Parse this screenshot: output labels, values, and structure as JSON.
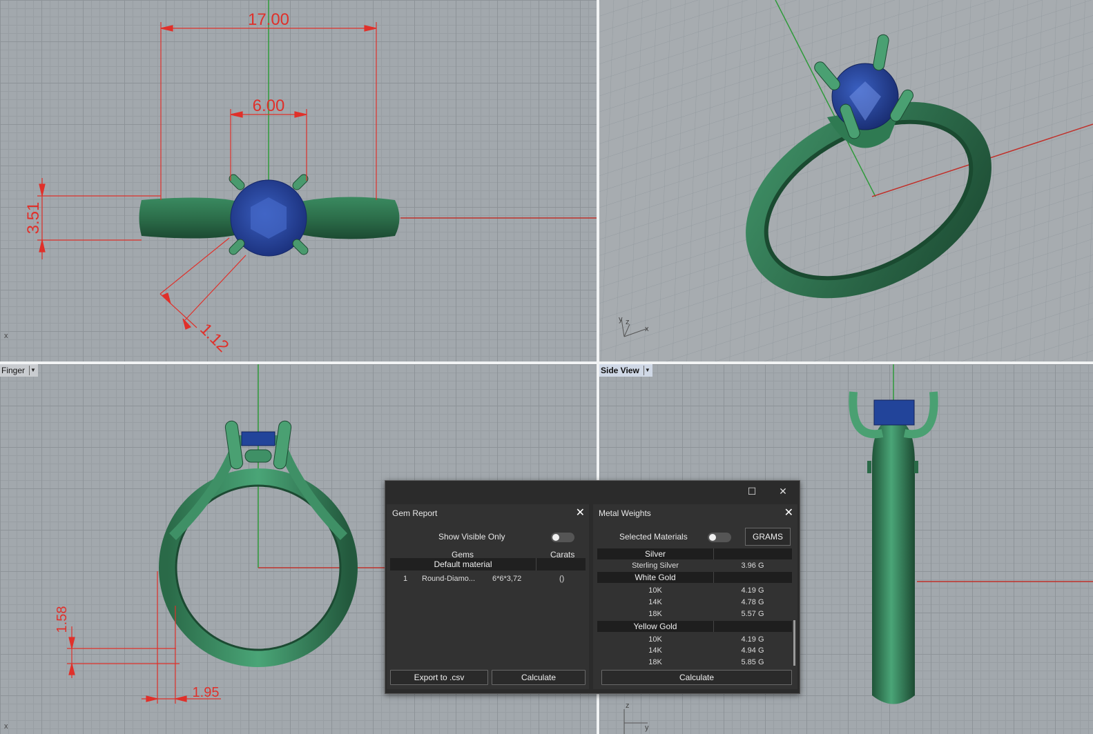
{
  "viewports": {
    "top": {
      "dims": {
        "width": "17.00",
        "inner": "6.00",
        "height": "3.51",
        "prong": "1.12"
      }
    },
    "perspective": {
      "axes": {
        "x": "x",
        "y": "y",
        "z": "z"
      }
    },
    "front": {
      "label": "Finger",
      "dims": {
        "shank_h": "1.58",
        "shank_w": "1.95"
      }
    },
    "right": {
      "label": "Side View",
      "axes": {
        "z": "z",
        "y": "y"
      }
    }
  },
  "axis_x_label": "x",
  "dialog": {
    "gem_report": {
      "title": "Gem Report",
      "show_visible_label": "Show Visible Only",
      "col_gems": "Gems",
      "col_carats": "Carats",
      "group": "Default material",
      "rows": [
        {
          "index": "1",
          "name": "Round-Diamo...",
          "size": "6*6*3,72",
          "carats": "()"
        }
      ],
      "export_label": "Export to .csv",
      "calculate_label": "Calculate"
    },
    "metal_weights": {
      "title": "Metal Weights",
      "selected_label": "Selected Materials",
      "unit_label": "GRAMS",
      "groups": [
        {
          "name": "Silver",
          "rows": [
            {
              "name": "Sterling Silver",
              "value": "3.96 G"
            }
          ]
        },
        {
          "name": "White Gold",
          "rows": [
            {
              "name": "10K",
              "value": "4.19 G"
            },
            {
              "name": "14K",
              "value": "4.78 G"
            },
            {
              "name": "18K",
              "value": "5.57 G"
            }
          ]
        },
        {
          "name": "Yellow Gold",
          "rows": [
            {
              "name": "10K",
              "value": "4.19 G"
            },
            {
              "name": "14K",
              "value": "4.94 G"
            },
            {
              "name": "18K",
              "value": "5.85 G"
            }
          ]
        }
      ],
      "calculate_label": "Calculate"
    }
  },
  "colors": {
    "metal": "#2f7a52",
    "gem": "#22449a",
    "dim": "#e0302a",
    "axis_green": "#2e9a3a",
    "axis_red": "#c0302a"
  }
}
